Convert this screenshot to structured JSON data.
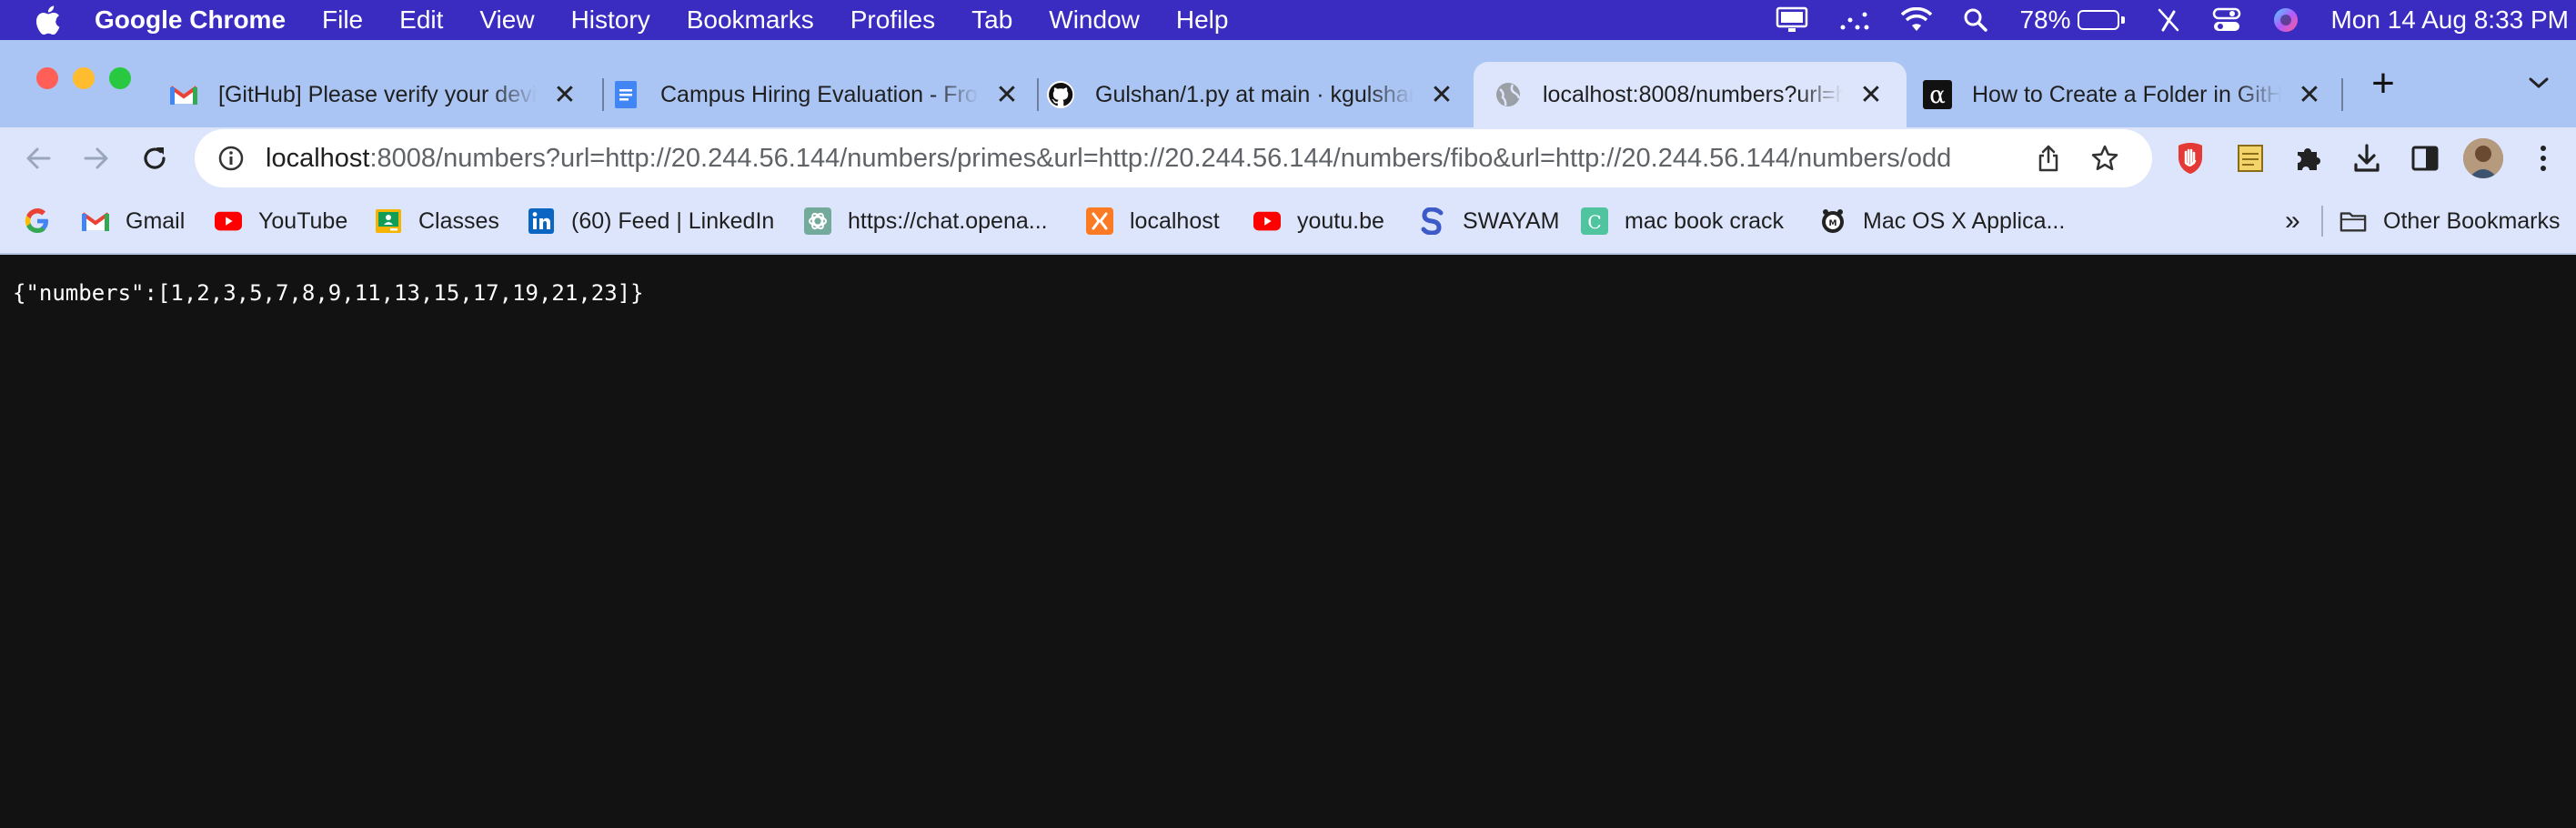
{
  "menubar": {
    "app_name": "Google Chrome",
    "menus": [
      "File",
      "Edit",
      "View",
      "History",
      "Bookmarks",
      "Profiles",
      "Tab",
      "Window",
      "Help"
    ],
    "battery_percent": "78%",
    "battery_level": 0.78,
    "clock": "Mon 14 Aug  8:33 PM"
  },
  "tabs": [
    {
      "title": "[GitHub] Please verify your device",
      "favicon": "gmail-icon",
      "active": false
    },
    {
      "title": "Campus Hiring Evaluation - Front",
      "favicon": "google-docs-icon",
      "active": false
    },
    {
      "title": "Gulshan/1.py at main · kgulshan",
      "favicon": "github-icon",
      "active": false
    },
    {
      "title": "localhost:8008/numbers?url=http",
      "favicon": "globe-icon",
      "active": true
    },
    {
      "title": "How to Create a Folder in GitHub",
      "favicon": "alpha-icon",
      "active": false
    }
  ],
  "omnibox": {
    "host": "localhost",
    "path": ":8008/numbers?url=http://20.244.56.144/numbers/primes&url=http://20.244.56.144/numbers/fibo&url=http://20.244.56.144/numbers/odd"
  },
  "bookmarks": [
    {
      "label": "",
      "icon": "google-icon"
    },
    {
      "label": "Gmail",
      "icon": "gmail-icon"
    },
    {
      "label": "YouTube",
      "icon": "youtube-icon"
    },
    {
      "label": "Classes",
      "icon": "classroom-icon"
    },
    {
      "label": "(60) Feed | LinkedIn",
      "icon": "linkedin-icon"
    },
    {
      "label": "https://chat.opena...",
      "icon": "openai-icon"
    },
    {
      "label": "localhost",
      "icon": "xampp-icon"
    },
    {
      "label": "youtu.be",
      "icon": "youtube-icon"
    },
    {
      "label": "SWAYAM",
      "icon": "swayam-icon"
    },
    {
      "label": "mac book crack",
      "icon": "c-icon"
    },
    {
      "label": "Mac OS X Applica...",
      "icon": "macapp-icon"
    }
  ],
  "other_bookmarks": "Other Bookmarks",
  "page": {
    "body": "{\"numbers\":[1,2,3,5,7,8,9,11,13,15,17,19,21,23]}"
  }
}
